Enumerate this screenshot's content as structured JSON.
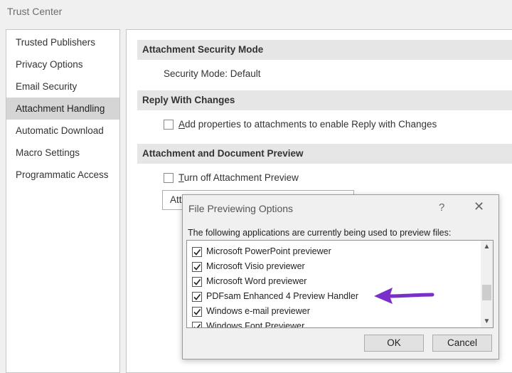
{
  "window": {
    "title": "Trust Center"
  },
  "sidebar": {
    "items": [
      {
        "label": "Trusted Publishers"
      },
      {
        "label": "Privacy Options"
      },
      {
        "label": "Email Security"
      },
      {
        "label": "Attachment Handling",
        "selected": true
      },
      {
        "label": "Automatic Download"
      },
      {
        "label": "Macro Settings"
      },
      {
        "label": "Programmatic Access"
      }
    ]
  },
  "main": {
    "security_mode": {
      "header": "Attachment Security Mode",
      "text": "Security Mode: Default"
    },
    "reply_with_changes": {
      "header": "Reply With Changes",
      "checkbox_accel": "A",
      "checkbox_rest": "dd properties to attachments to enable Reply with Changes",
      "checked": false
    },
    "preview": {
      "header": "Attachment and Document Preview",
      "checkbox_accel": "T",
      "checkbox_rest": "urn off Attachment Preview",
      "checked": false,
      "combo_text": "Att"
    }
  },
  "dialog": {
    "title": "File Previewing Options",
    "help": "?",
    "close": "✕",
    "description": "The following applications are currently being used to preview files:",
    "items": [
      {
        "label": "Microsoft PowerPoint previewer",
        "checked": true
      },
      {
        "label": "Microsoft Visio previewer",
        "checked": true
      },
      {
        "label": "Microsoft Word previewer",
        "checked": true
      },
      {
        "label": "PDFsam Enhanced 4 Preview Handler",
        "checked": true
      },
      {
        "label": "Windows e-mail previewer",
        "checked": true
      },
      {
        "label": "Windows Font Previewer",
        "checked": true
      }
    ],
    "ok_label": "OK",
    "cancel_label": "Cancel"
  },
  "colors": {
    "annotation_arrow": "#7b2fc9"
  }
}
